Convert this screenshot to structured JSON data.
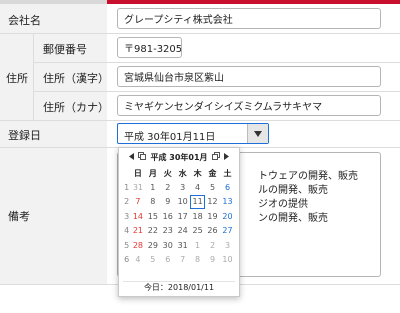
{
  "form": {
    "company": {
      "label": "会社名",
      "value": "グレープシティ株式会社"
    },
    "address": {
      "group_label": "住所",
      "postal": {
        "label": "郵便番号",
        "value": "〒981-3205"
      },
      "kanji": {
        "label": "住所（漢字）",
        "value": "宮城県仙台市泉区紫山"
      },
      "kana": {
        "label": "住所（カナ）",
        "value": "ミヤギケンセンダイシイズミクムラサキヤマ"
      }
    },
    "registered": {
      "label": "登録日",
      "value": "平成 30年01月11日",
      "dropdown_icon": "triangle-down-icon"
    },
    "remarks": {
      "label": "備考",
      "lines": [
        "トウェアの開発、販売",
        "ルの開発、販売",
        "ジオの提供",
        "ンの開発、販売"
      ]
    }
  },
  "calendar": {
    "title": "平成 30年01月",
    "prev_icon": "triangle-left-icon",
    "next_icon": "triangle-right-icon",
    "weekdays": [
      "日",
      "月",
      "火",
      "水",
      "木",
      "金",
      "土"
    ],
    "weeks": [
      {
        "num": "1",
        "days": [
          "31",
          "1",
          "2",
          "3",
          "4",
          "5",
          "6"
        ]
      },
      {
        "num": "2",
        "days": [
          "7",
          "8",
          "9",
          "10",
          "11",
          "12",
          "13"
        ]
      },
      {
        "num": "3",
        "days": [
          "14",
          "15",
          "16",
          "17",
          "18",
          "19",
          "20"
        ]
      },
      {
        "num": "4",
        "days": [
          "21",
          "22",
          "23",
          "24",
          "25",
          "26",
          "27"
        ]
      },
      {
        "num": "5",
        "days": [
          "28",
          "29",
          "30",
          "31",
          "1",
          "2",
          "3"
        ]
      },
      {
        "num": "6",
        "days": [
          "4",
          "5",
          "6",
          "7",
          "8",
          "9",
          "10"
        ]
      }
    ],
    "today_label": "今日：2018/01/11",
    "colors": {
      "sunday": "#e53935",
      "saturday": "#1e6fd9",
      "selected_border": "#1e6fd9",
      "accent": "#c8102e"
    }
  }
}
